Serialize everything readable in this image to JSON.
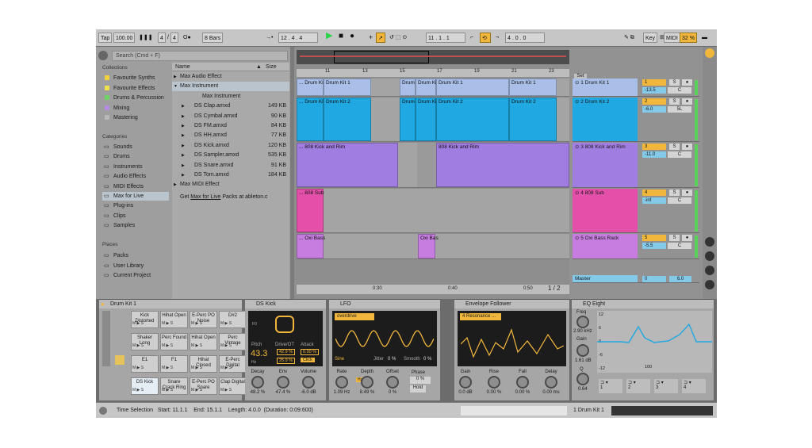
{
  "transport": {
    "tap": "Tap",
    "tempo": "100.00",
    "signature": "4 / 4",
    "sig_num": "4",
    "sig_den": "4",
    "metro": "O●",
    "quantize": "8 Bars",
    "pos": "12 . 4 . 4",
    "loop_start": "11 . 1 . 1",
    "loop_len": "4 . 0 . 0",
    "key": "Key",
    "midi": "MIDI",
    "cpu": "32 %"
  },
  "browser": {
    "search": "Search (Cmd + F)",
    "collections_title": "Collections",
    "collections": [
      {
        "label": "Favourite Synths",
        "color": "#f2d13c"
      },
      {
        "label": "Favourite Effects",
        "color": "#efe24a"
      },
      {
        "label": "Drums & Percussion",
        "color": "#6fd36a"
      },
      {
        "label": "Mixing",
        "color": "#b38ee3"
      },
      {
        "label": "Mastering",
        "color": "#b8b8b8"
      }
    ],
    "categories_title": "Categories",
    "categories": [
      {
        "label": "Sounds",
        "icon": "note-icon"
      },
      {
        "label": "Drums",
        "icon": "drum-icon"
      },
      {
        "label": "Instruments",
        "icon": "instrument-icon"
      },
      {
        "label": "Audio Effects",
        "icon": "audio-fx-icon"
      },
      {
        "label": "MIDI Effects",
        "icon": "midi-fx-icon"
      },
      {
        "label": "Max for Live",
        "icon": "max-icon"
      },
      {
        "label": "Plug-ins",
        "icon": "plugin-icon"
      },
      {
        "label": "Clips",
        "icon": "clip-icon"
      },
      {
        "label": "Samples",
        "icon": "sample-icon"
      }
    ],
    "places_title": "Places",
    "places": [
      {
        "label": "Packs"
      },
      {
        "label": "User Library"
      },
      {
        "label": "Current Project"
      }
    ],
    "col_name": "Name",
    "col_size": "Size",
    "files": [
      {
        "name": "Max Audio Effect",
        "size": "",
        "indent": 0,
        "arrow": "▶"
      },
      {
        "name": "Max Instrument",
        "size": "",
        "indent": 0,
        "arrow": "▼",
        "sel": true
      },
      {
        "name": "Max Instrument",
        "size": "",
        "indent": 2,
        "arrow": ""
      },
      {
        "name": "DS Clap.amxd",
        "size": "149 KB",
        "indent": 1,
        "arrow": "▶"
      },
      {
        "name": "DS Cymbal.amxd",
        "size": "90 KB",
        "indent": 1,
        "arrow": "▶"
      },
      {
        "name": "DS FM.amxd",
        "size": "84 KB",
        "indent": 1,
        "arrow": "▶"
      },
      {
        "name": "DS HH.amxd",
        "size": "77 KB",
        "indent": 1,
        "arrow": "▶"
      },
      {
        "name": "DS Kick.amxd",
        "size": "120 KB",
        "indent": 1,
        "arrow": "▶"
      },
      {
        "name": "DS Sampler.amxd",
        "size": "535 KB",
        "indent": 1,
        "arrow": "▶"
      },
      {
        "name": "DS Snare.amxd",
        "size": "91 KB",
        "indent": 1,
        "arrow": "▶"
      },
      {
        "name": "DS Tom.amxd",
        "size": "184 KB",
        "indent": 1,
        "arrow": "▶"
      },
      {
        "name": "Max MIDI Effect",
        "size": "",
        "indent": 0,
        "arrow": "▶"
      }
    ],
    "footer_pre": "Get",
    "footer_link": "Max for Live",
    "footer_post": "Packs at ableton.c"
  },
  "arrangement": {
    "bars": [
      "11",
      "13",
      "15",
      "17",
      "19",
      "21",
      "23"
    ],
    "times": [
      "0:30",
      "0:40",
      "0:50"
    ],
    "page": "1 / 2",
    "set_label": "Set",
    "tracks": [
      {
        "name": "1 Drum Kit 1",
        "num": "1",
        "vol": "-13.5",
        "pan": "C",
        "color": "#a9bfe8",
        "clips": [
          "... Drum Kit",
          "Drum Kit 1",
          "Drum Ki",
          "Drum Kit",
          "Drum Kit 1",
          "Drum Kit 1"
        ]
      },
      {
        "name": "2 Drum Kit 2",
        "num": "2",
        "vol": "-6.0",
        "pan": "5L",
        "color": "#1fa8e1",
        "clips": [
          "... Drum Kit",
          "Drum Kit 2",
          "Drum Ki",
          "Drum Kit",
          "Drum Kit 2",
          "Drum Kit 2"
        ]
      },
      {
        "name": "3 808 Kick and Rim",
        "num": "3",
        "vol": "-11.0",
        "pan": "C",
        "color": "#a07de0",
        "clips": [
          "... 808 Kick and Rim",
          "808 Kick and Rim"
        ]
      },
      {
        "name": "4 808 Sub",
        "num": "4",
        "vol": "-inf",
        "pan": "C",
        "color": "#e34fa9",
        "clips": [
          "... 808 Sub"
        ]
      },
      {
        "name": "5 Oxi Bass Rack",
        "num": "5",
        "vol": "-5.5",
        "pan": "C",
        "color": "#c77ddf",
        "clips": [
          "... Oxi Bass",
          "Oxi Bas"
        ]
      }
    ],
    "master": {
      "name": "Master",
      "vol": "0",
      "pan": "6.0"
    }
  },
  "devices": {
    "drumrack": {
      "title": "Drum Kit 1",
      "pads": [
        [
          "Kick Distorted",
          "Hihat Open",
          "E-Perc PO Noise",
          "D#2"
        ],
        [
          "Shaker Long",
          "Perc Found",
          "Hihat Open",
          "Perc Vintage"
        ],
        [
          "E1",
          "F1",
          "Hihat Closed",
          "E-Perc Digital"
        ],
        [
          "DS Kick",
          "Snare Crack Ring",
          "E-Perc PO Snare",
          "Clap Digital"
        ]
      ],
      "btn_m": "M",
      "btn_s": "S"
    },
    "dskick": {
      "title": "DS Kick",
      "pitch_label": "Pitch",
      "pitch": "43.3",
      "pitch_unit": "Hz",
      "drive_label": "Drive/OT",
      "drive": "42.9 %",
      "attack_label": "Attack",
      "attack": "0.00 %",
      "drive2": "25.9 %",
      "click": "Click",
      "f0": "F0",
      "knobs": [
        {
          "label": "Decay",
          "value": "48.2 %"
        },
        {
          "label": "Env",
          "value": "47.4 %"
        },
        {
          "label": "Volume",
          "value": "-6.0 dB"
        }
      ]
    },
    "lfo": {
      "title": "LFO",
      "mode": "overdrive",
      "wave": "Sine",
      "jitter_label": "Jitter",
      "jitter": "0 %",
      "smooth_label": "Smooth",
      "smooth": "0 %",
      "hz": "Hz",
      "knobs": [
        {
          "label": "Rate",
          "value": "1.09 Hz"
        },
        {
          "label": "Depth",
          "value": "8.49 %"
        },
        {
          "label": "Offset",
          "value": "0 %"
        }
      ],
      "phase_label": "Phase",
      "phase": "0 %",
      "hold": "Hold"
    },
    "envf": {
      "title": "Envelope Follower",
      "mode": "4 Resonance ...",
      "knobs": [
        {
          "label": "Gain",
          "value": "0.0 dB"
        },
        {
          "label": "Rise",
          "value": "0.00 %"
        },
        {
          "label": "Fall",
          "value": "0.00 %"
        },
        {
          "label": "Delay",
          "value": "0.00 ms"
        }
      ]
    },
    "eq": {
      "title": "EQ Eight",
      "freq_label": "Freq",
      "freq": "2.90 kHz",
      "gain_label": "Gain",
      "gain": "1.61 dB",
      "q_label": "Q",
      "q": "0.64",
      "db_ticks": [
        "12",
        "6",
        "0",
        "-6",
        "-12"
      ],
      "freq_tick": "100",
      "bands": [
        "1",
        "2",
        "3",
        "4"
      ]
    }
  },
  "status": {
    "text": "Time Selection   Start: 11.1.1    End: 15.1.1    Length: 4.0.0  (Duration: 0:09:600)",
    "track": "1 Drum Kit 1"
  }
}
